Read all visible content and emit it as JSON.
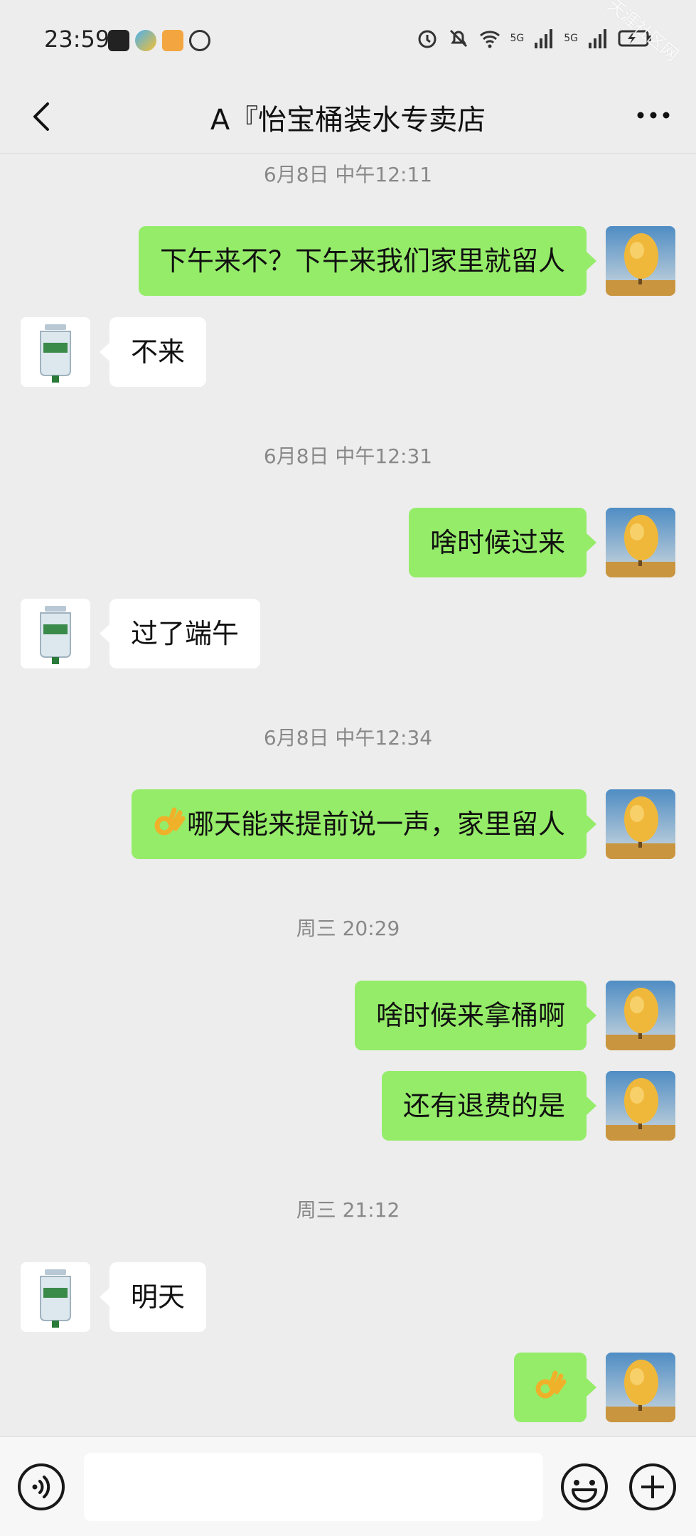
{
  "status_bar": {
    "time": "23:59",
    "network_labels": [
      "5G",
      "5G"
    ],
    "watermark": "天涯社区网"
  },
  "nav": {
    "title": "A『怡宝桶装水专卖店"
  },
  "messages": [
    {
      "type": "time",
      "text": "6月8日 中午12:11"
    },
    {
      "type": "sent",
      "text": "下午来不？下午来我们家里就留人"
    },
    {
      "type": "recv",
      "text": "不来"
    },
    {
      "type": "time",
      "text": "6月8日 中午12:31"
    },
    {
      "type": "sent",
      "text": "啥时候过来"
    },
    {
      "type": "recv",
      "text": "过了端午"
    },
    {
      "type": "time",
      "text": "6月8日 中午12:34"
    },
    {
      "type": "sent",
      "text": "哪天能来提前说一声，家里留人",
      "emoji": "ok-hand"
    },
    {
      "type": "time",
      "text": "周三 20:29"
    },
    {
      "type": "sent",
      "text": "啥时候来拿桶啊"
    },
    {
      "type": "sent",
      "text": "还有退费的是"
    },
    {
      "type": "time",
      "text": "周三 21:12"
    },
    {
      "type": "recv",
      "text": "明天"
    },
    {
      "type": "sent",
      "text": "",
      "emoji": "ok-hand"
    }
  ],
  "input_bar": {
    "placeholder": "",
    "icons": [
      "voice-icon",
      "emoji-icon",
      "plus-icon"
    ]
  },
  "colors": {
    "sent_bubble": "#95ec69",
    "recv_bubble": "#ffffff",
    "background": "#ededed"
  }
}
